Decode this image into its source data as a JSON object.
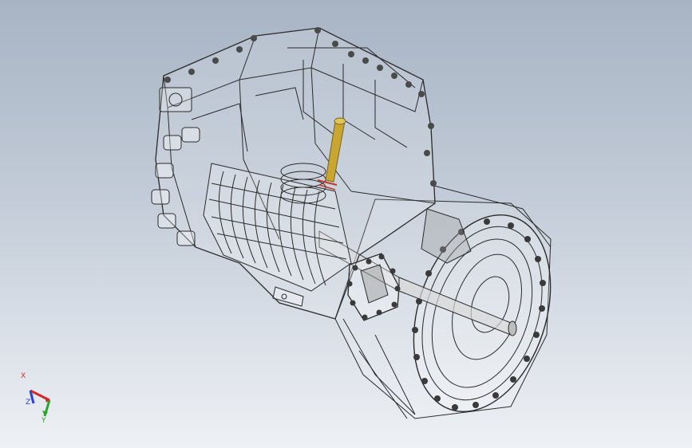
{
  "viewport": {
    "background_top": "#a7b4c4",
    "background_bottom": "#eef1f5",
    "model_outline_color": "#2b2b2b",
    "highlight_part_color": "#c9a531",
    "accent_part_color": "#c0392b"
  },
  "triad": {
    "x_label": "X",
    "y_label": "Y",
    "z_label": "Z",
    "x_color": "#d42a2a",
    "y_color": "#2aa52a",
    "z_color": "#2a43d4"
  }
}
